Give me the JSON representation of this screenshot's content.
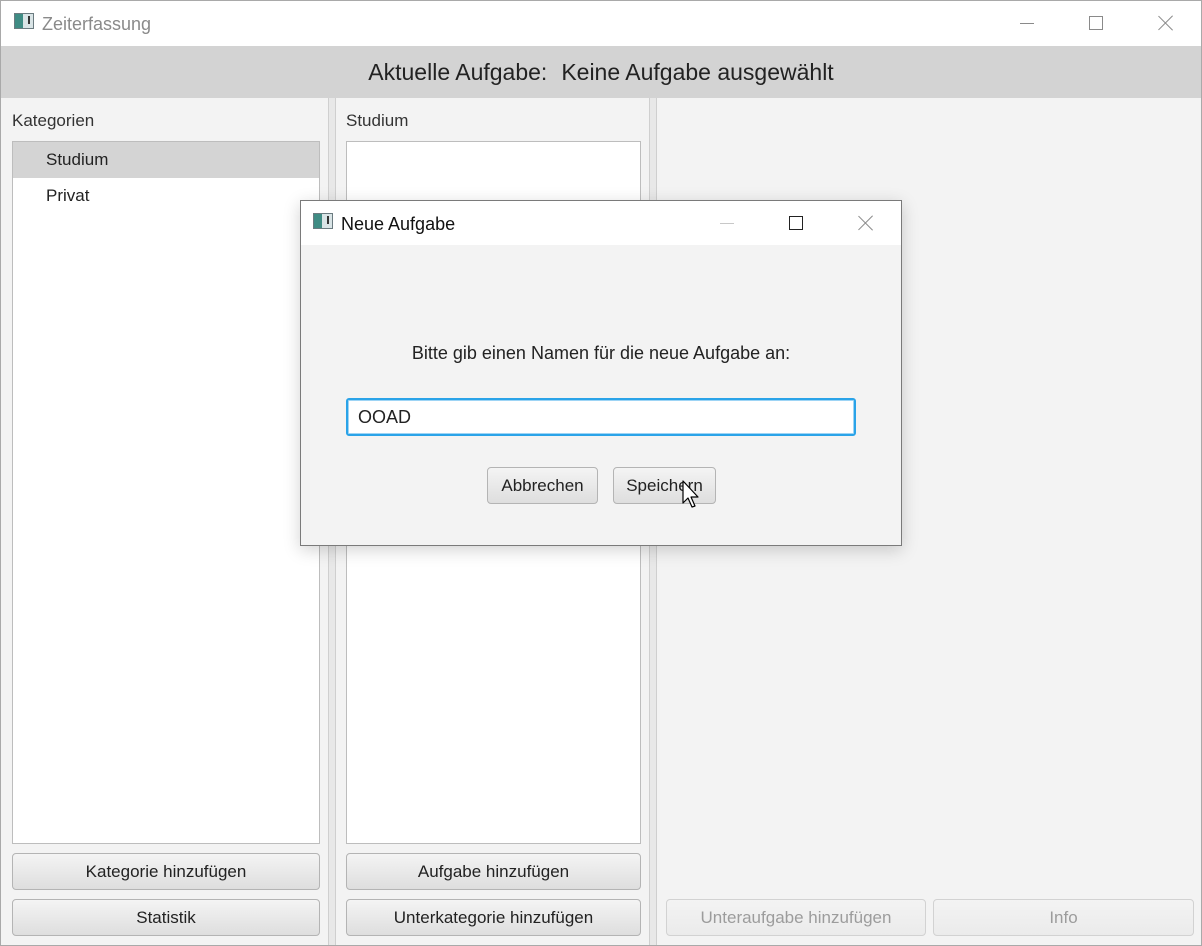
{
  "main_window": {
    "title": "Zeiterfassung",
    "header_prefix": "Aktuelle Aufgabe:",
    "header_value": "Keine Aufgabe ausgewählt"
  },
  "categories_panel": {
    "label": "Kategorien",
    "items": [
      "Studium",
      "Privat"
    ],
    "selected": "Studium",
    "add_button": "Kategorie hinzufügen",
    "stats_button": "Statistik"
  },
  "tasks_panel": {
    "label": "Studium",
    "add_task_button": "Aufgabe hinzufügen",
    "add_subcategory_button": "Unterkategorie hinzufügen"
  },
  "details_panel": {
    "add_subtask_button": "Unteraufgabe hinzufügen",
    "info_button": "Info"
  },
  "dialog": {
    "title": "Neue Aufgabe",
    "message": "Bitte gib einen Namen für die neue Aufgabe an:",
    "input_value": "OOAD",
    "cancel_button": "Abbrechen",
    "save_button": "Speichern"
  },
  "icons": {
    "app": "app-window-icon",
    "minimize": "minimize-icon",
    "maximize": "maximize-icon",
    "close": "close-icon",
    "cursor": "mouse-pointer-icon"
  },
  "colors": {
    "header_bar": "#d3d3d3",
    "input_focus": "#2aa3e8",
    "selected_item": "#d4d4d4"
  }
}
